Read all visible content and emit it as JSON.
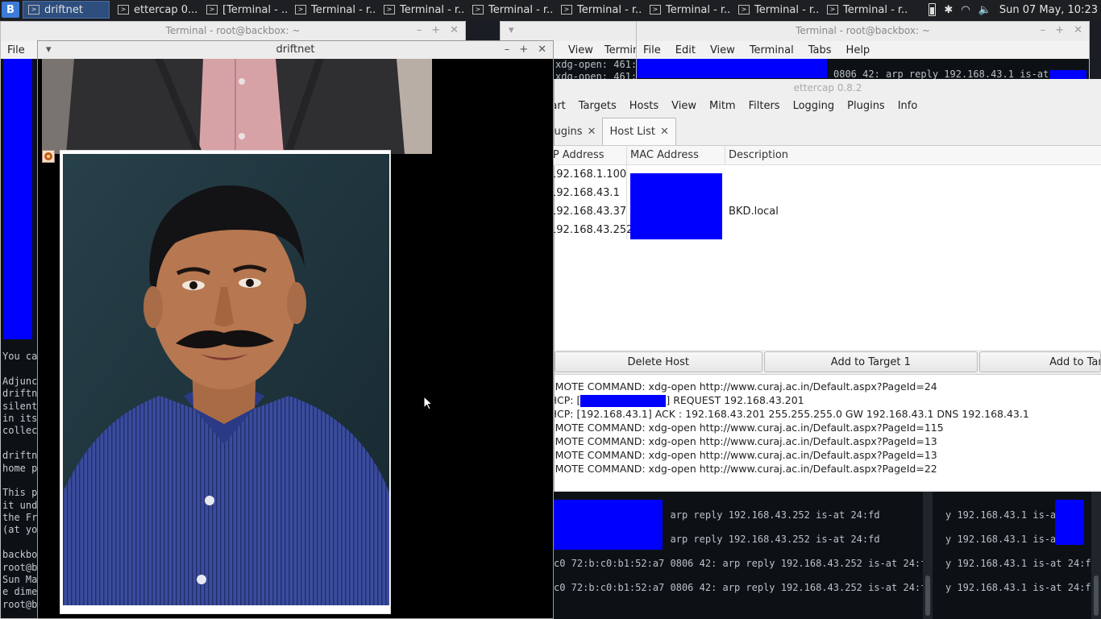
{
  "taskbar": {
    "start_label": "B",
    "tasks": [
      {
        "label": "driftnet",
        "active": true
      },
      {
        "label": "ettercap 0...."
      },
      {
        "label": "[Terminal - ..."
      },
      {
        "label": "Terminal - r..."
      },
      {
        "label": "Terminal - r..."
      },
      {
        "label": "Terminal - r..."
      },
      {
        "label": "Terminal - r..."
      },
      {
        "label": "Terminal - r..."
      },
      {
        "label": "Terminal - r..."
      },
      {
        "label": "Terminal - r..."
      }
    ],
    "clock": "Sun 07 May, 10:23"
  },
  "term_left": {
    "title": "Terminal - root@backbox: ~",
    "menu_file": "File",
    "lines": [
      "You ca",
      "",
      "Adjunc",
      "driftn",
      "silent",
      "in its",
      "collec",
      "",
      "driftn",
      "home p",
      "",
      "This p",
      "it und",
      "the Fr",
      "(at yo",
      "",
      "backbo",
      "root@b",
      "Sun Ma",
      "e dime",
      "root@b"
    ]
  },
  "term_mid": {
    "menu_view": "View",
    "menu_term": "Termin",
    "lines": [
      "xdg-open: 461:",
      "xdg-open: 461:"
    ]
  },
  "term_right": {
    "title": "Terminal - root@backbox: ~",
    "menu": [
      "File",
      "Edit",
      "View",
      "Terminal",
      "Tabs",
      "Help"
    ],
    "line": "0806 42: arp reply 192.168.43.1 is-at"
  },
  "ettercap": {
    "title": "ettercap 0.8.2",
    "menu": [
      "Start",
      "Targets",
      "Hosts",
      "View",
      "Mitm",
      "Filters",
      "Logging",
      "Plugins",
      "Info"
    ],
    "tabs": [
      {
        "label": "Plugins",
        "active": false
      },
      {
        "label": "Host List",
        "active": true
      }
    ],
    "columns": [
      "IP Address",
      "MAC Address",
      "Description"
    ],
    "hosts": [
      {
        "ip": "192.168.1.100",
        "mac": "",
        "desc": ""
      },
      {
        "ip": "192.168.43.1",
        "mac": "",
        "desc": ""
      },
      {
        "ip": "192.168.43.37",
        "mac": "",
        "desc": "BKD.local"
      },
      {
        "ip": "192.168.43.252",
        "mac": "",
        "desc": ""
      }
    ],
    "buttons": [
      "Delete Host",
      "Add to Target 1",
      "Add to Target 2"
    ],
    "log": [
      "REMOTE COMMAND: xdg-open http://www.curaj.ac.in/Default.aspx?PageId=24",
      "DHCP: [",
      "] REQUEST 192.168.43.201",
      "DHCP: [192.168.43.1] ACK : 192.168.43.201 255.255.255.0 GW 192.168.43.1 DNS 192.168.43.1",
      "REMOTE COMMAND: xdg-open http://www.curaj.ac.in/Default.aspx?PageId=115",
      "REMOTE COMMAND: xdg-open http://www.curaj.ac.in/Default.aspx?PageId=13",
      "REMOTE COMMAND: xdg-open http://www.curaj.ac.in/Default.aspx?PageId=13",
      "REMOTE COMMAND: xdg-open http://www.curaj.ac.in/Default.aspx?PageId=22"
    ]
  },
  "bottom_terms": {
    "left_lines": [
      "           0806 42: arp reply 192.168.43.252 is-at 24:fd",
      "           0806 42: arp reply 192.168.43.252 is-at 24:fd",
      "c0 72:b:c0:b1:52:a7 0806 42: arp reply 192.168.43.252 is-at 24:fd",
      "c0 72:b:c0:b1:52:a7 0806 42: arp reply 192.168.43.252 is-at 24:fd"
    ],
    "right_lines": [
      "y 192.168.43.1 is-at      :",
      "y 192.168.43.1 is-at      :",
      "y 192.168.43.1 is-at 24:fd:",
      "y 192.168.43.1 is-at 24:fd:"
    ]
  },
  "driftnet": {
    "title": "driftnet"
  }
}
